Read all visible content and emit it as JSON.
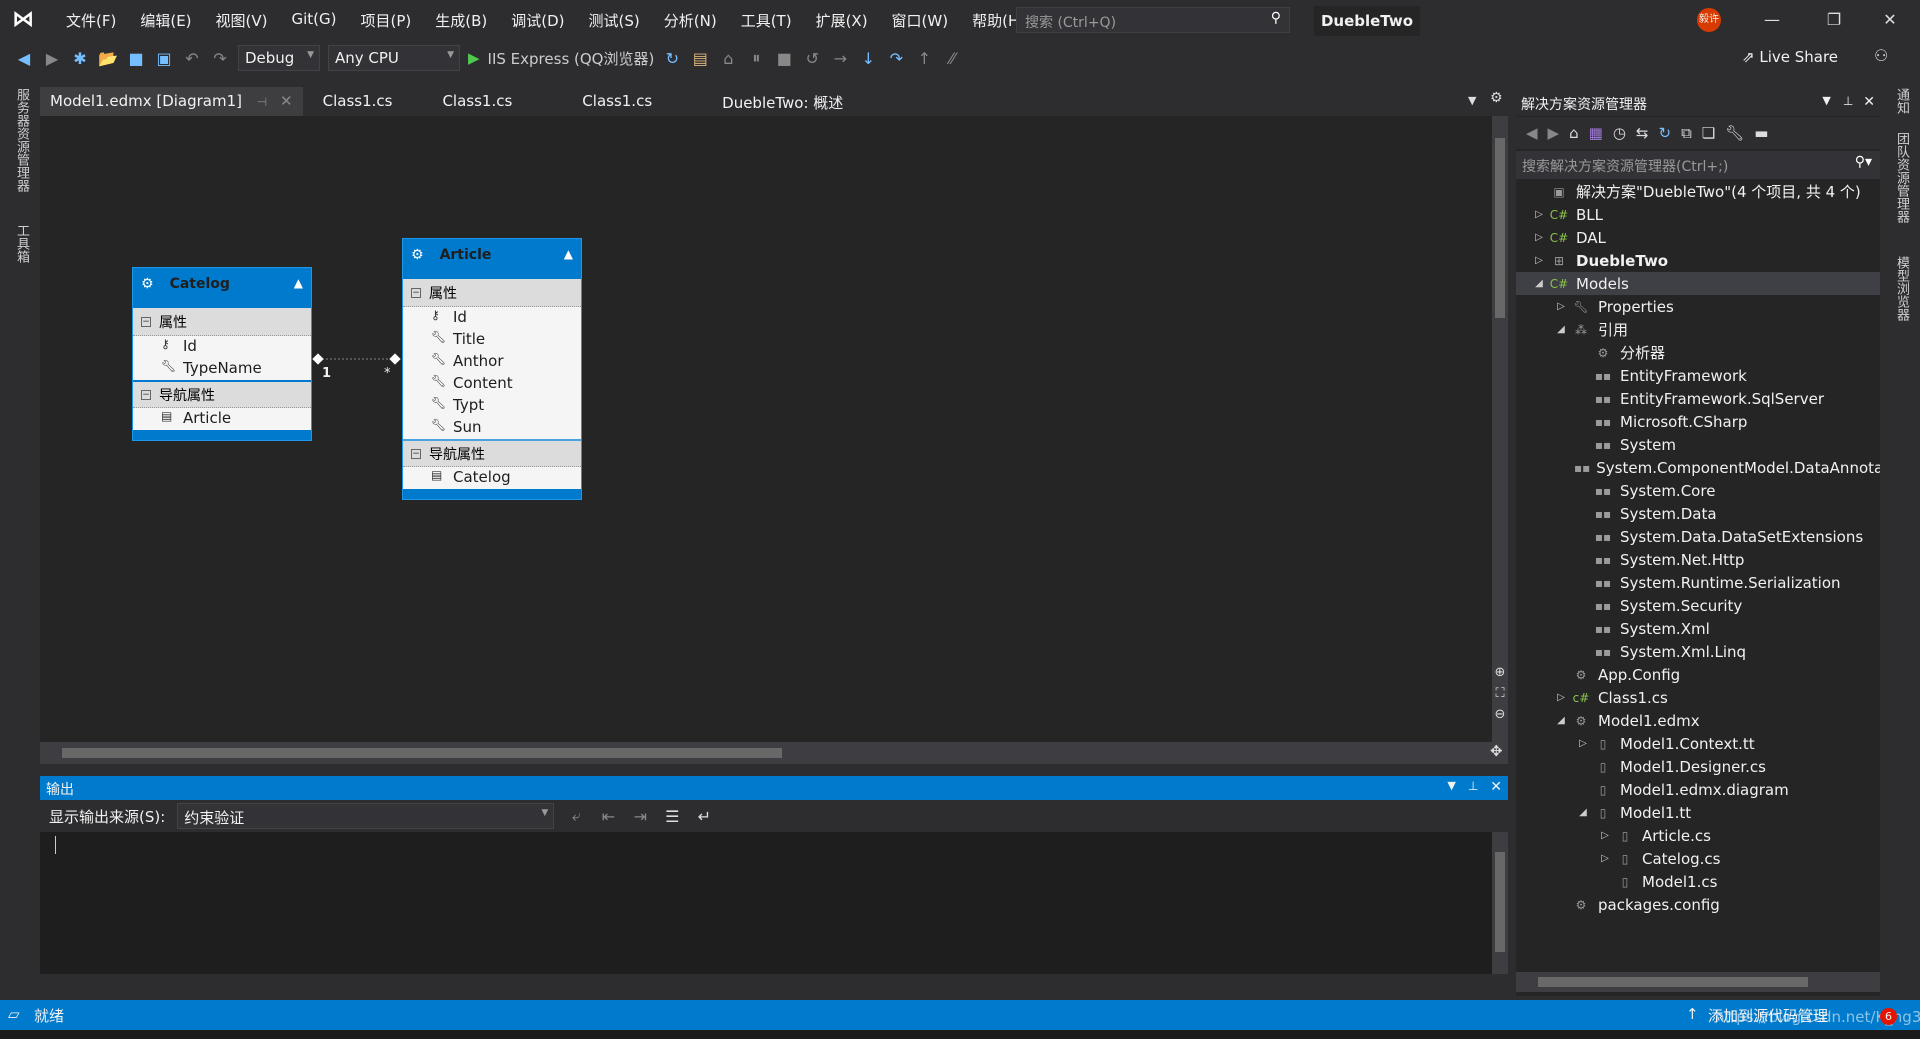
{
  "title": {
    "menu": [
      "文件(F)",
      "编辑(E)",
      "视图(V)",
      "Git(G)",
      "项目(P)",
      "生成(B)",
      "调试(D)",
      "测试(S)",
      "分析(N)",
      "工具(T)",
      "扩展(X)",
      "窗口(W)",
      "帮助(H)"
    ],
    "search_placeholder": "搜索 (Ctrl+Q)",
    "project": "DuebleTwo",
    "avatar": "毅许"
  },
  "toolbar": {
    "config": "Debug",
    "platform": "Any CPU",
    "run": "IIS Express (QQ浏览器)",
    "live_share": "Live Share"
  },
  "left_strip": [
    "服务器资源管理器",
    "工具箱"
  ],
  "right_strip": [
    "通知",
    "团队资源管理器",
    "模型浏览器"
  ],
  "tabs": [
    "Model1.edmx [Diagram1]",
    "Class1.cs",
    "Class1.cs",
    "Class1.cs",
    "DuebleTwo: 概述"
  ],
  "diagram": {
    "entities": [
      {
        "name": "Catelog",
        "props_header": "属性",
        "props": [
          "Id",
          "TypeName"
        ],
        "nav_header": "导航属性",
        "nav": [
          "Article"
        ]
      },
      {
        "name": "Article",
        "props_header": "属性",
        "props": [
          "Id",
          "Title",
          "Anthor",
          "Content",
          "Typt",
          "Sun"
        ],
        "nav_header": "导航属性",
        "nav": [
          "Catelog"
        ]
      }
    ],
    "association": {
      "from_mult": "1",
      "to_mult": "*"
    }
  },
  "output": {
    "title": "输出",
    "source_label": "显示输出来源(S):",
    "source_value": "约束验证"
  },
  "solution_explorer": {
    "title": "解决方案资源管理器",
    "search_placeholder": "搜索解决方案资源管理器(Ctrl+;)",
    "items": [
      {
        "label": "解决方案\"DuebleTwo\"(4 个项目, 共 4 个)",
        "level": 0,
        "exp": "",
        "icon": "solution-icon"
      },
      {
        "label": "BLL",
        "level": 0,
        "exp": "▷",
        "icon": "csharp-project-icon"
      },
      {
        "label": "DAL",
        "level": 0,
        "exp": "▷",
        "icon": "csharp-project-icon"
      },
      {
        "label": "DuebleTwo",
        "level": 0,
        "exp": "▷",
        "icon": "web-project-icon",
        "bold": true
      },
      {
        "label": "Models",
        "level": 0,
        "exp": "◢",
        "icon": "csharp-project-icon",
        "selected": true
      },
      {
        "label": "Properties",
        "level": 1,
        "exp": "▷",
        "icon": "wrench-icon"
      },
      {
        "label": "引用",
        "level": 1,
        "exp": "◢",
        "icon": "references-icon"
      },
      {
        "label": "分析器",
        "level": 2,
        "exp": "",
        "icon": "analyzer-icon"
      },
      {
        "label": "EntityFramework",
        "level": 2,
        "exp": "",
        "icon": "reference-icon"
      },
      {
        "label": "EntityFramework.SqlServer",
        "level": 2,
        "exp": "",
        "icon": "reference-icon"
      },
      {
        "label": "Microsoft.CSharp",
        "level": 2,
        "exp": "",
        "icon": "reference-icon"
      },
      {
        "label": "System",
        "level": 2,
        "exp": "",
        "icon": "reference-icon"
      },
      {
        "label": "System.ComponentModel.DataAnnotations",
        "level": 2,
        "exp": "",
        "icon": "reference-icon"
      },
      {
        "label": "System.Core",
        "level": 2,
        "exp": "",
        "icon": "reference-icon"
      },
      {
        "label": "System.Data",
        "level": 2,
        "exp": "",
        "icon": "reference-icon"
      },
      {
        "label": "System.Data.DataSetExtensions",
        "level": 2,
        "exp": "",
        "icon": "reference-icon"
      },
      {
        "label": "System.Net.Http",
        "level": 2,
        "exp": "",
        "icon": "reference-icon"
      },
      {
        "label": "System.Runtime.Serialization",
        "level": 2,
        "exp": "",
        "icon": "reference-icon"
      },
      {
        "label": "System.Security",
        "level": 2,
        "exp": "",
        "icon": "reference-icon"
      },
      {
        "label": "System.Xml",
        "level": 2,
        "exp": "",
        "icon": "reference-icon"
      },
      {
        "label": "System.Xml.Linq",
        "level": 2,
        "exp": "",
        "icon": "reference-icon"
      },
      {
        "label": "App.Config",
        "level": 1,
        "exp": "",
        "icon": "config-icon"
      },
      {
        "label": "Class1.cs",
        "level": 1,
        "exp": "▷",
        "icon": "csharp-file-icon"
      },
      {
        "label": "Model1.edmx",
        "level": 1,
        "exp": "◢",
        "icon": "edmx-icon"
      },
      {
        "label": "Model1.Context.tt",
        "level": 2,
        "exp": "▷",
        "icon": "file-icon"
      },
      {
        "label": "Model1.Designer.cs",
        "level": 2,
        "exp": "",
        "icon": "file-icon"
      },
      {
        "label": "Model1.edmx.diagram",
        "level": 2,
        "exp": "",
        "icon": "file-icon"
      },
      {
        "label": "Model1.tt",
        "level": 2,
        "exp": "◢",
        "icon": "file-icon"
      },
      {
        "label": "Article.cs",
        "level": 3,
        "exp": "▷",
        "icon": "file-icon"
      },
      {
        "label": "Catelog.cs",
        "level": 3,
        "exp": "▷",
        "icon": "file-icon"
      },
      {
        "label": "Model1.cs",
        "level": 3,
        "exp": "",
        "icon": "file-icon"
      },
      {
        "label": "packages.config",
        "level": 1,
        "exp": "",
        "icon": "config-icon"
      }
    ]
  },
  "status": {
    "ready": "就绪",
    "source_control": "添加到源代码管理",
    "notifications": "6",
    "watermark": "https://blog.csdn.net/K_ng3"
  },
  "colors": {
    "accent": "#007acc",
    "background": "#2d2d30",
    "editor": "#252526"
  }
}
